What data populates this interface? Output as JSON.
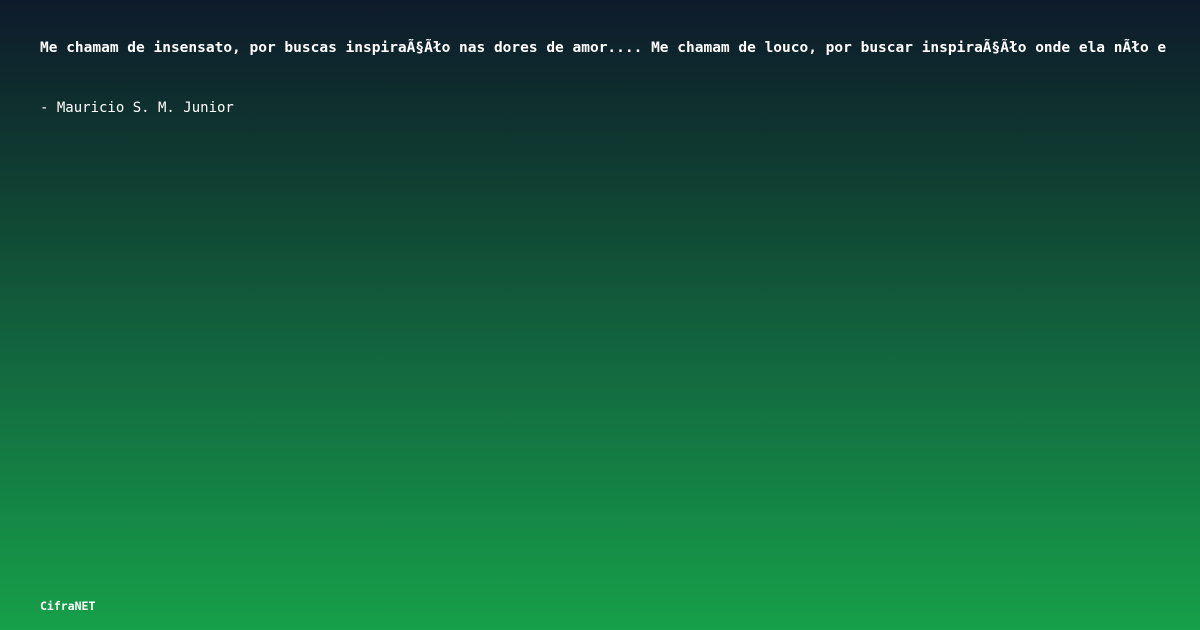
{
  "quote": {
    "text": "Me chamam de insensato, por buscas inspiraÃ§Ãło nas dores de amor.... Me chamam de louco, por buscar inspiraÃ§Ãło onde ela nÃło e"
  },
  "author": {
    "text": "- Mauricio S. M. Junior"
  },
  "brand": {
    "text": "CifraNET"
  },
  "colors": {
    "background_top": "#0e1a2b",
    "background_bottom": "#16a049",
    "text": "#ffffff"
  }
}
